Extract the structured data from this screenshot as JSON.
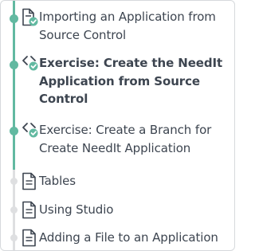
{
  "colors": {
    "completed_accent": "#62b9a1",
    "pending_track": "#dedfe1",
    "text": "#3d4550"
  },
  "items": [
    {
      "label": "Importing an Application from Source Control",
      "icon": "document-complete-icon",
      "status": "completed",
      "current": false
    },
    {
      "label": "Exercise: Create the NeedIt Application from Source Control",
      "icon": "code-complete-icon",
      "status": "completed",
      "current": true
    },
    {
      "label": "Exercise: Create a Branch for Create NeedIt Application",
      "icon": "code-complete-icon",
      "status": "completed",
      "current": false
    },
    {
      "label": "Tables",
      "icon": "document-icon",
      "status": "pending",
      "current": false
    },
    {
      "label": "Using Studio",
      "icon": "document-icon",
      "status": "pending",
      "current": false
    },
    {
      "label": "Adding a File to an Application",
      "icon": "document-icon",
      "status": "pending",
      "current": false
    }
  ]
}
